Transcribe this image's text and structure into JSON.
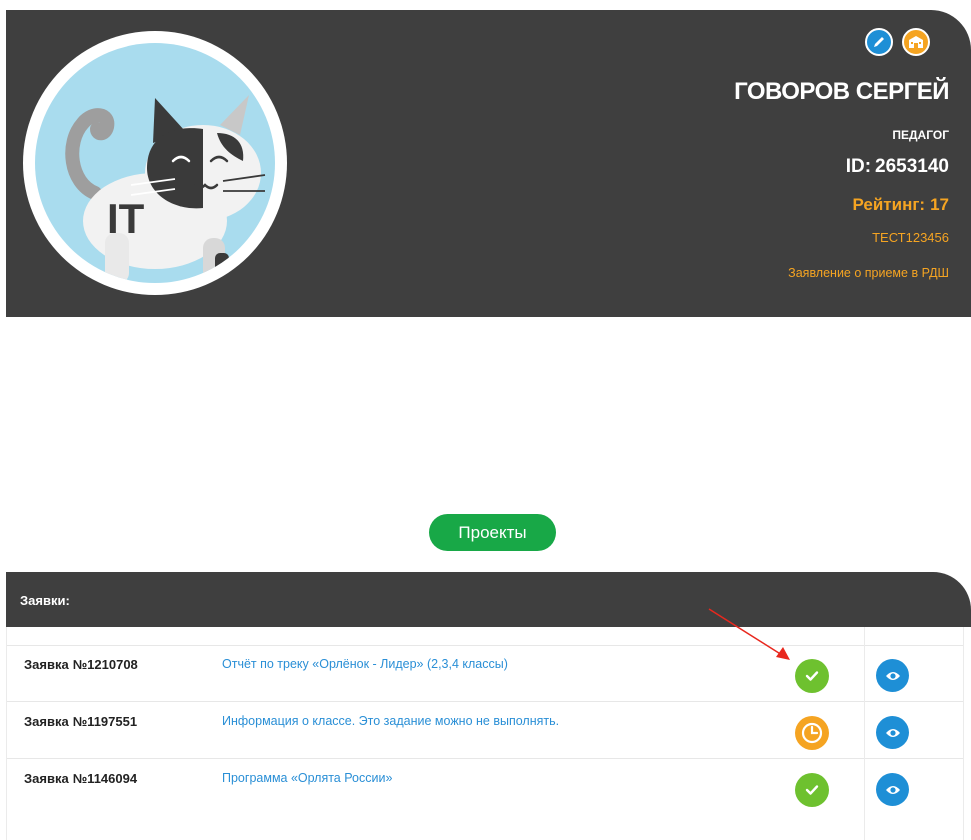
{
  "profile": {
    "name": "ГОВОРОВ СЕРГЕЙ",
    "role": "ПЕДАГОГ",
    "id_label": "ID:",
    "id_value": "2653140",
    "rating_label": "Рейтинг:",
    "rating_value": "17",
    "test_code": "ТЕСТ123456",
    "rdsh_link": "Заявление о приеме в РДШ",
    "avatar_text": "IT",
    "icons": {
      "edit": "pencil-icon",
      "school": "school-building-icon"
    }
  },
  "projects_button": "Проекты",
  "applications": {
    "title": "Заявки:",
    "rows": [
      {
        "label": "Заявка",
        "number": "№1210708",
        "link": "Отчёт по треку «Орлёнок - Лидер» (2,3,4 классы)",
        "status": "done",
        "status_icon": "check-icon",
        "view_icon": "eye-icon"
      },
      {
        "label": "Заявка",
        "number": "№1197551",
        "link": "Информация о классе. Это задание можно не выполнять.",
        "status": "pending",
        "status_icon": "clock-icon",
        "view_icon": "eye-icon"
      },
      {
        "label": "Заявка",
        "number": "№1146094",
        "link": "Программа «Орлята России»",
        "status": "done",
        "status_icon": "check-icon",
        "view_icon": "eye-icon"
      }
    ]
  },
  "colors": {
    "header_bg": "#3f3f3f",
    "accent_orange": "#f5a422",
    "accent_blue": "#1e8fd6",
    "success_green": "#6ec12f",
    "button_green": "#18a847",
    "annotation_red": "#e8281e"
  }
}
